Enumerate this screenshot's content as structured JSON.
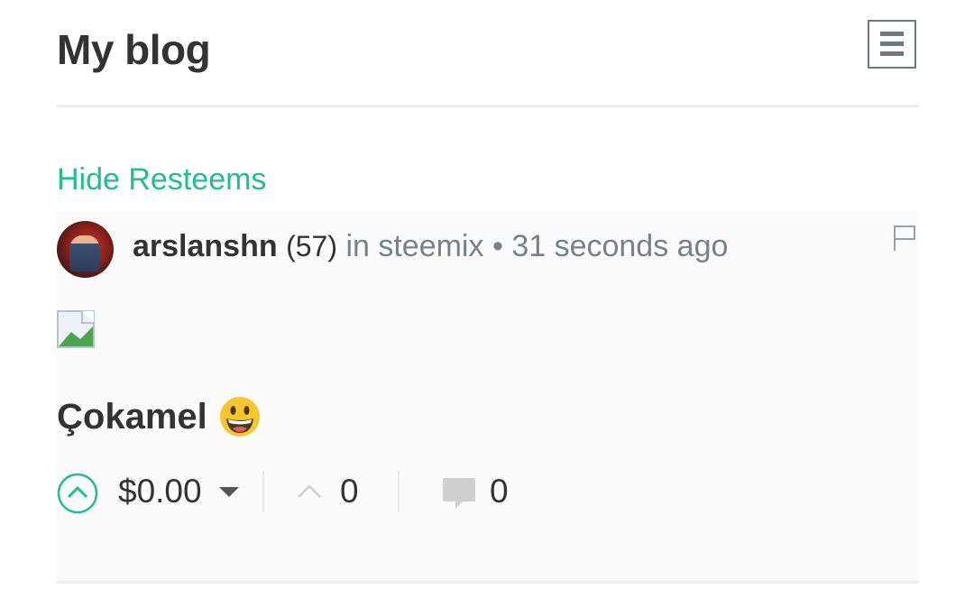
{
  "header": {
    "title": "My blog",
    "menu_icon": "hamburger-icon"
  },
  "controls": {
    "hide_resteems": "Hide Resteems"
  },
  "post": {
    "author": "arslanshn",
    "reputation": "(57)",
    "community": "in steemix",
    "separator": "•",
    "time": "31 seconds ago",
    "title": "Çokamel",
    "title_emoji": "grinning-face-emoji",
    "payout": "$0.00",
    "votes": "0",
    "comments": "0"
  },
  "colors": {
    "accent": "#1fbf8f",
    "text": "#333333",
    "muted": "#788187"
  }
}
